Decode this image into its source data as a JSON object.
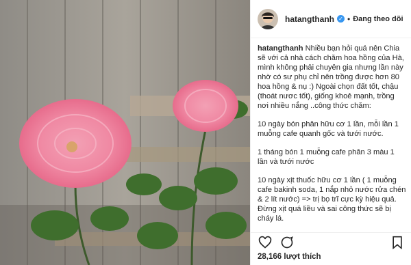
{
  "post": {
    "username": "hatangthanh",
    "follow_status": "Đang theo dõi",
    "caption_username": "hatangthanh",
    "caption_paragraphs": [
      "Nhiều bạn hỏi quá nên Chia sẽ với cả nhà cách chăm hoa hồng của Hà, mình không phải chuyên gia nhưng lần này nhờ có sư phụ chỉ nên trồng được hơn 80 hoa hồng & nụ :) Ngoài chọn đất tốt, chậu (thoát nươc tốt), giống khoẻ mạnh, trồng nơi nhiều nắng ..công thức chăm:",
      "10 ngày bón phân hữu cơ 1 lần, mỗi lần 1 muỗng cafe quanh gốc và tưới nước.",
      "1 tháng bón 1 muỗng cafe phân 3 màu 1 lần và tưới nước",
      "10 ngày xịt thuốc hữu cơ 1 lần ( 1 muỗng cafe bakinh soda, 1 nắp nhỏ nước rửa chén & 2 lít nước) => trị bọ trĩ cực kỳ hiệu quả. Đừng xịt quá liều và sai công thức sẽ bị cháy lá."
    ],
    "likes": "28,166 lượt thích"
  },
  "icons": {
    "verified": "verified-badge-icon",
    "like": "heart-icon",
    "comment": "comment-icon",
    "save": "bookmark-icon"
  },
  "colors": {
    "verified": "#3897f0",
    "text": "#262626"
  }
}
